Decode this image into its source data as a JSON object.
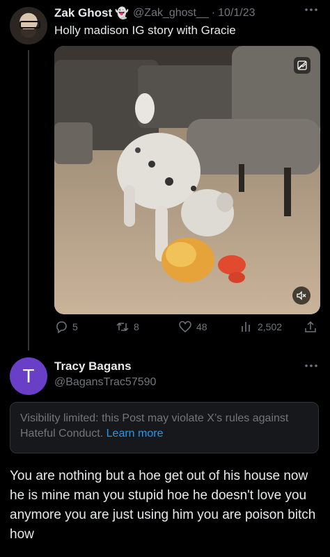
{
  "tweet": {
    "author_name": "Zak Ghost",
    "author_emoji": "👻",
    "handle": "@Zak_ghost__",
    "separator": "·",
    "date": "10/1/23",
    "text": "Holly madison IG story with Gracie",
    "more_icon": "more-horizontal-icon",
    "media_icons": [
      "image-description-icon",
      "mute-icon"
    ],
    "stats": {
      "replies": "5",
      "retweets": "8",
      "likes": "48",
      "views": "2,502"
    }
  },
  "reply": {
    "avatar_letter": "T",
    "author_name": "Tracy Bagans",
    "handle": "@BagansTrac57590",
    "notice_text": "Visibility limited: this Post may violate X’s rules against Hateful Conduct.",
    "notice_link": "Learn more",
    "text": "You are nothing but a hoe get out of his house now he is mine  man you stupid hoe he doesn't love you anymore you are just using him   you are poison bitch how"
  },
  "colors": {
    "background": "#000000",
    "text": "#e7e9ea",
    "muted": "#71767b",
    "link": "#1d9bf0",
    "avatar_purple": "#6a3fc8"
  }
}
